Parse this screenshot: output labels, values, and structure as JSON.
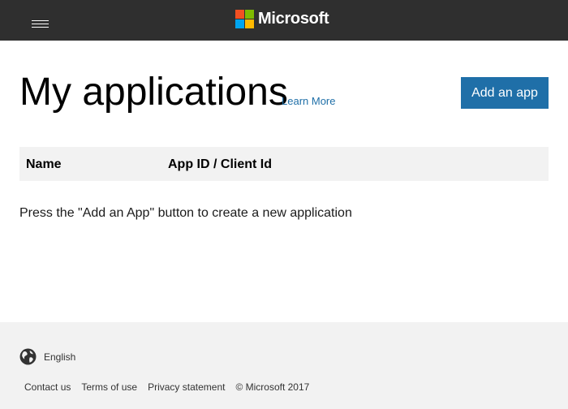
{
  "header": {
    "brand_name": "Microsoft",
    "colors": {
      "background": "#2f2f2f",
      "logo_red": "#f25022",
      "logo_green": "#7fba00",
      "logo_blue": "#00a4ef",
      "logo_yellow": "#ffb900"
    }
  },
  "main": {
    "title": "My applications",
    "learn_more_label": "Learn More",
    "add_app_label": "Add an app",
    "accent_color": "#1f6fa8",
    "table": {
      "columns": [
        "Name",
        "App ID / Client Id"
      ],
      "rows": []
    },
    "empty_message": "Press the \"Add an App\" button to create a new application"
  },
  "footer": {
    "language": "English",
    "links": [
      "Contact us",
      "Terms of use",
      "Privacy statement"
    ],
    "copyright": "© Microsoft 2017"
  }
}
